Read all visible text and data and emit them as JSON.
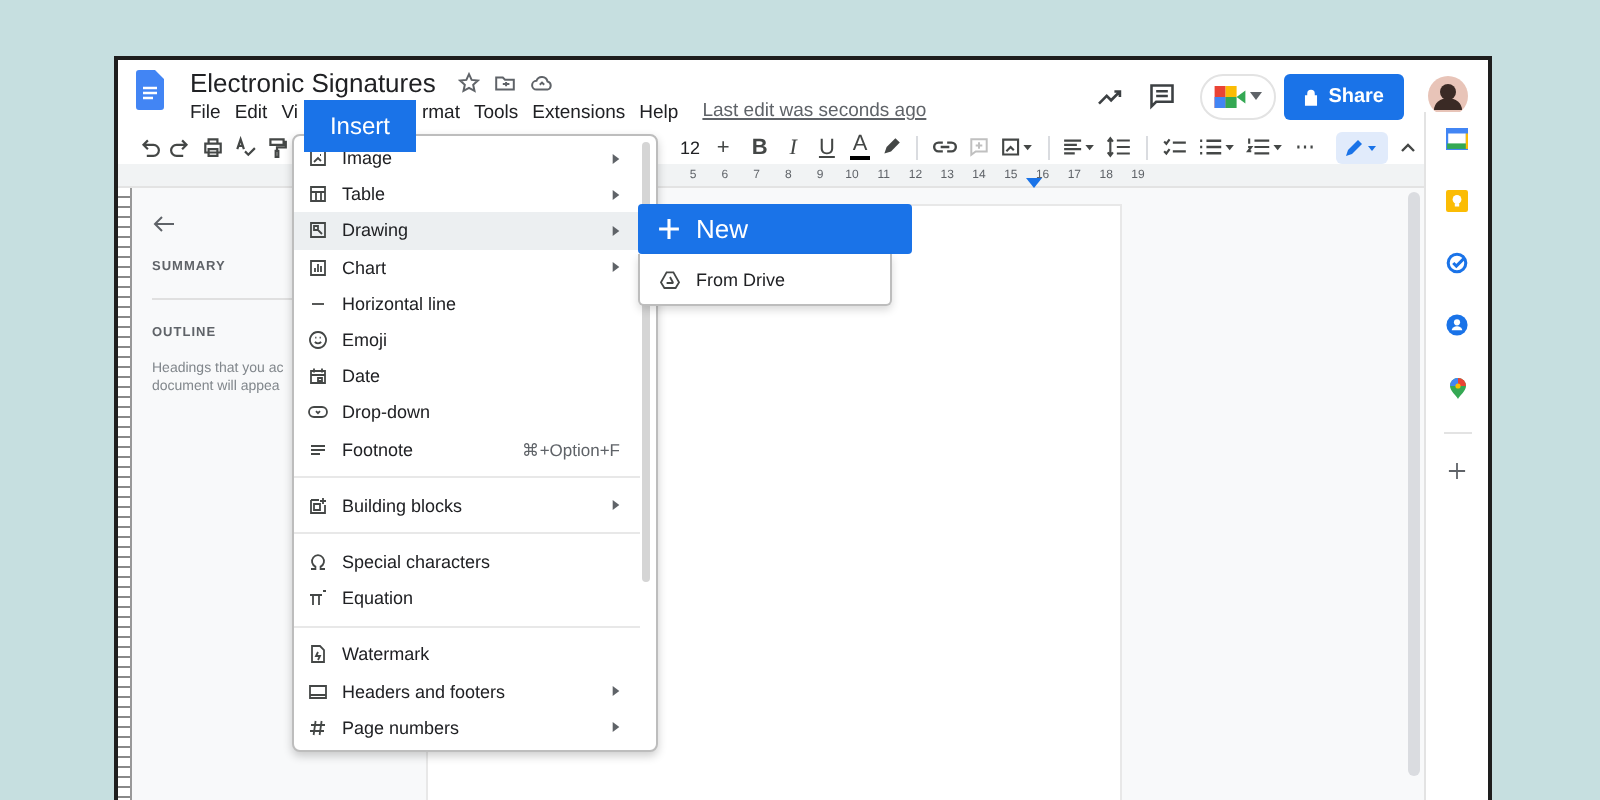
{
  "document": {
    "title": "Electronic Signatures",
    "last_edit": "Last edit was seconds ago"
  },
  "menu_bar": [
    {
      "label": "File",
      "selected": false
    },
    {
      "label": "Edit",
      "selected": false
    },
    {
      "label": "Vi",
      "selected": false
    },
    {
      "label": "Insert",
      "selected": true
    },
    {
      "label": "rmat",
      "selected": false
    },
    {
      "label": "Tools",
      "selected": false
    },
    {
      "label": "Extensions",
      "selected": false
    },
    {
      "label": "Help",
      "selected": false
    }
  ],
  "share_button": "Share",
  "toolbar": {
    "font_size": "12",
    "increase": "+",
    "bold": "B",
    "italic": "I",
    "underline": "U",
    "text_color": "A"
  },
  "ruler": [
    "5",
    "6",
    "7",
    "8",
    "9",
    "10",
    "11",
    "12",
    "13",
    "14",
    "15",
    "16",
    "17",
    "18",
    "19"
  ],
  "outline_panel": {
    "summary": "SUMMARY",
    "outline": "OUTLINE",
    "hint_lines": [
      "Headings that you ac",
      "document will appea"
    ]
  },
  "insert_menu": [
    [
      {
        "kind": "image",
        "label": "Image",
        "submenu": true,
        "selected": false
      },
      {
        "kind": "table",
        "label": "Table",
        "submenu": true,
        "selected": false
      },
      {
        "kind": "drawing",
        "label": "Drawing",
        "submenu": true,
        "selected": true
      },
      {
        "kind": "chart",
        "label": "Chart",
        "submenu": true,
        "selected": false
      },
      {
        "kind": "line",
        "label": "Horizontal line",
        "submenu": false,
        "selected": false
      },
      {
        "kind": "emoji",
        "label": "Emoji",
        "submenu": false,
        "selected": false
      },
      {
        "kind": "date",
        "label": "Date",
        "submenu": false,
        "selected": false
      },
      {
        "kind": "dropdown",
        "label": "Drop-down",
        "submenu": false,
        "selected": false
      },
      {
        "kind": "footnote",
        "label": "Footnote",
        "shortcut": "⌘+Option+F",
        "submenu": false,
        "selected": false
      }
    ],
    [
      {
        "kind": "blocks",
        "label": "Building blocks",
        "submenu": true,
        "selected": false
      }
    ],
    [
      {
        "kind": "symbols",
        "label": "Special characters",
        "submenu": false,
        "selected": false
      },
      {
        "kind": "equation",
        "label": "Equation",
        "submenu": false,
        "selected": false
      }
    ],
    [
      {
        "kind": "watermark",
        "label": "Watermark",
        "submenu": false,
        "selected": false
      },
      {
        "kind": "headers",
        "label": "Headers and footers",
        "submenu": true,
        "selected": false
      },
      {
        "kind": "page_numbers",
        "label": "Page numbers",
        "submenu": true,
        "selected": false
      }
    ]
  ],
  "drawing_submenu": [
    {
      "kind": "new",
      "label": "New",
      "selected": true
    },
    {
      "kind": "drive",
      "label": "From Drive",
      "selected": false
    }
  ]
}
